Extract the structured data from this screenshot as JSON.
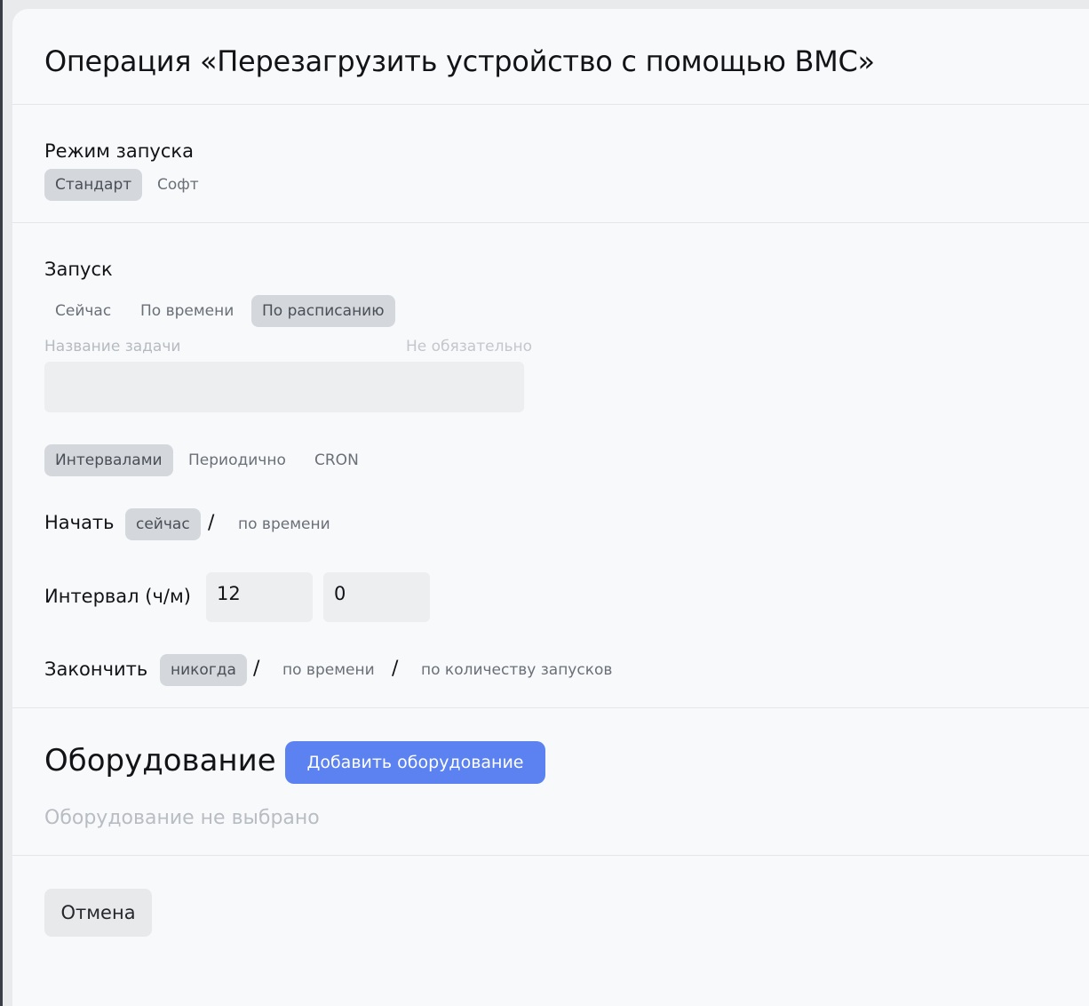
{
  "title": "Операция «Перезагрузить устройство с помощью ВМС»",
  "launch_mode": {
    "label": "Режим запуска",
    "options": [
      "Стандарт",
      "Софт"
    ],
    "selected": "Стандарт"
  },
  "launch": {
    "label": "Запуск",
    "options": [
      "Сейчас",
      "По времени",
      "По расписанию"
    ],
    "selected": "По расписанию"
  },
  "task_name": {
    "label": "Название задачи",
    "hint": "Не обязательно",
    "value": "",
    "placeholder": ""
  },
  "schedule_type": {
    "options": [
      "Интервалами",
      "Периодично",
      "CRON"
    ],
    "selected": "Интервалами"
  },
  "start": {
    "label": "Начать",
    "options": [
      "сейчас",
      "по времени"
    ],
    "selected": "сейчас",
    "separator": "/"
  },
  "interval": {
    "label": "Интервал (ч/м)",
    "hours": "12",
    "minutes": "0"
  },
  "finish": {
    "label": "Закончить",
    "options": [
      "никогда",
      "по времени",
      "по количеству запусков"
    ],
    "selected": "никогда",
    "separator": "/"
  },
  "equipment": {
    "title": "Оборудование",
    "add_button": "Добавить оборудование",
    "empty_text": "Оборудование не выбрано"
  },
  "footer": {
    "cancel_button": "Отмена"
  },
  "colors": {
    "accent": "#5b82f0",
    "active_segment": "#d4d7db",
    "panel_bg": "#f8f9fa"
  }
}
